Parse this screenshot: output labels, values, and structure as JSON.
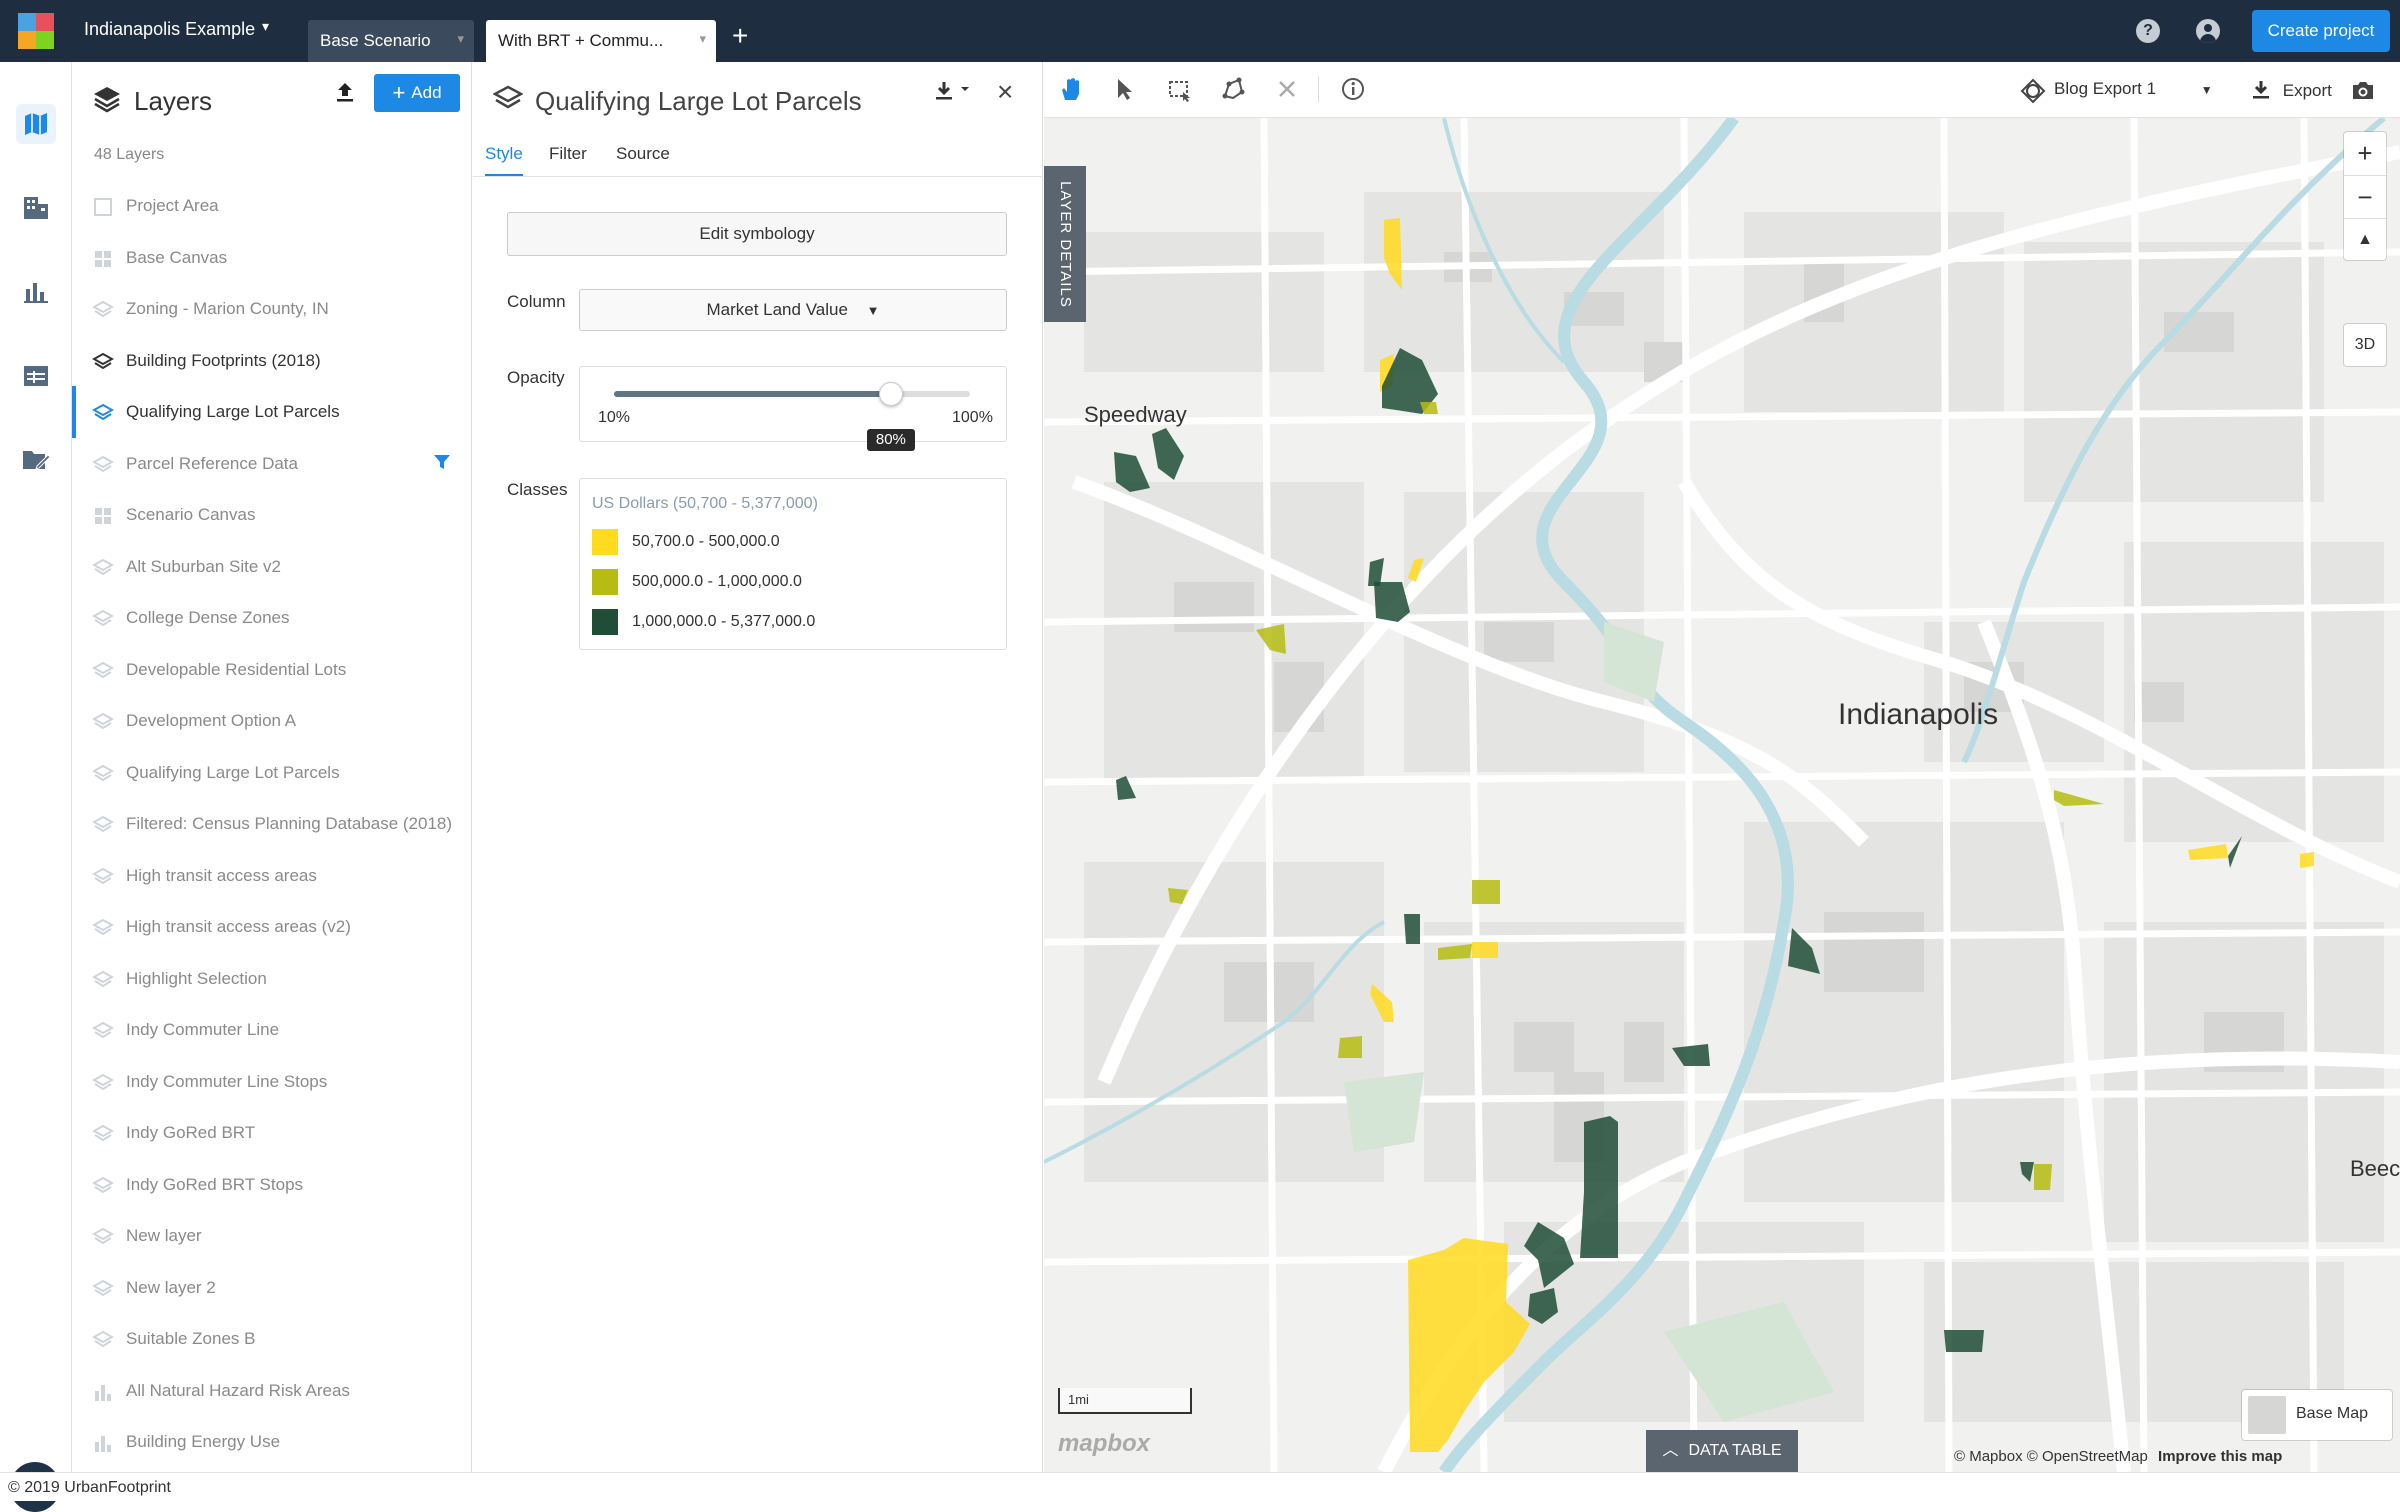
{
  "header": {
    "project_name": "Indianapolis Example",
    "tabs": [
      {
        "label": "Base Scenario",
        "active": false
      },
      {
        "label": "With BRT + Commu...",
        "active": true
      }
    ],
    "create_project_label": "Create project",
    "help_icon": "help-icon",
    "user_icon": "user-icon"
  },
  "rail": {
    "items": [
      "map-icon",
      "building-icon",
      "chart-icon",
      "table-icon",
      "folder-edit-icon"
    ],
    "active": "map-icon"
  },
  "layers_panel": {
    "title": "Layers",
    "add_label": "Add",
    "count_label": "48 Layers",
    "layers": [
      {
        "label": "Project Area",
        "icon": "polygon",
        "state": "inactive"
      },
      {
        "label": "Base Canvas",
        "icon": "grid",
        "state": "inactive"
      },
      {
        "label": "Zoning - Marion County, IN",
        "icon": "layers",
        "state": "inactive"
      },
      {
        "label": "Building Footprints (2018)",
        "icon": "layers",
        "state": "visible"
      },
      {
        "label": "Qualifying Large Lot Parcels",
        "icon": "layers",
        "state": "selected"
      },
      {
        "label": "Parcel Reference Data",
        "icon": "layers",
        "state": "inactive",
        "filter": true
      },
      {
        "label": "Scenario Canvas",
        "icon": "grid",
        "state": "inactive"
      },
      {
        "label": "Alt Suburban Site v2",
        "icon": "layers",
        "state": "inactive"
      },
      {
        "label": "College Dense Zones",
        "icon": "layers",
        "state": "inactive"
      },
      {
        "label": "Developable Residential Lots",
        "icon": "layers",
        "state": "inactive"
      },
      {
        "label": "Development Option A",
        "icon": "layers",
        "state": "inactive"
      },
      {
        "label": "Qualifying Large Lot Parcels",
        "icon": "layers",
        "state": "inactive"
      },
      {
        "label": "Filtered: Census Planning Database (2018)",
        "icon": "layers",
        "state": "inactive"
      },
      {
        "label": "High transit access areas",
        "icon": "layers",
        "state": "inactive"
      },
      {
        "label": "High transit access areas (v2)",
        "icon": "layers",
        "state": "inactive"
      },
      {
        "label": "Highlight Selection",
        "icon": "layers",
        "state": "inactive"
      },
      {
        "label": "Indy Commuter Line",
        "icon": "layers",
        "state": "inactive"
      },
      {
        "label": "Indy Commuter Line Stops",
        "icon": "layers",
        "state": "inactive"
      },
      {
        "label": "Indy GoRed BRT",
        "icon": "layers",
        "state": "inactive"
      },
      {
        "label": "Indy GoRed BRT Stops",
        "icon": "layers",
        "state": "inactive"
      },
      {
        "label": "New layer",
        "icon": "layers",
        "state": "inactive"
      },
      {
        "label": "New layer 2",
        "icon": "layers",
        "state": "inactive"
      },
      {
        "label": "Suitable Zones B",
        "icon": "layers",
        "state": "inactive"
      },
      {
        "label": "All Natural Hazard Risk Areas",
        "icon": "bars",
        "state": "inactive"
      },
      {
        "label": "Building Energy Use",
        "icon": "bars",
        "state": "inactive"
      }
    ]
  },
  "layer_detail": {
    "title": "Qualifying Large Lot Parcels",
    "tabs": [
      "Style",
      "Filter",
      "Source"
    ],
    "active_tab": "Style",
    "edit_symbology_label": "Edit symbology",
    "column_label": "Column",
    "column_value": "Market Land Value",
    "opacity_label": "Opacity",
    "opacity_value": 0.8,
    "opacity_display": "80%",
    "opacity_min_label": "10%",
    "opacity_max_label": "100%",
    "classes_label": "Classes",
    "classes_title": "US Dollars (50,700 - 5,377,000)",
    "classes": [
      {
        "label": "50,700.0 - 500,000.0",
        "color": "#ffdb1f"
      },
      {
        "label": "500,000.0 - 1,000,000.0",
        "color": "#b6bc12"
      },
      {
        "label": "1,000,000.0 - 5,377,000.0",
        "color": "#1f4d36"
      }
    ]
  },
  "map": {
    "toolbar_tools": [
      "pan-hand-icon",
      "select-pointer-icon",
      "select-box-icon",
      "polygon-select-icon",
      "clear-selection-icon",
      "info-icon"
    ],
    "view_name": "Blog Export 1",
    "export_label": "Export",
    "layer_details_tab": "LAYER DETAILS",
    "three_d_label": "3D",
    "city_labels": {
      "indianapolis": "Indianapolis",
      "speedway": "Speedway",
      "beech": "Beec"
    },
    "scale_label": "1mi",
    "mapbox_logo": "mapbox",
    "data_table_label": "DATA TABLE",
    "base_map_label": "Base Map",
    "attribution": {
      "text": "© Mapbox © OpenStreetMap",
      "link": "Improve this map"
    }
  },
  "footer": {
    "copyright": "© 2019 UrbanFootprint"
  }
}
